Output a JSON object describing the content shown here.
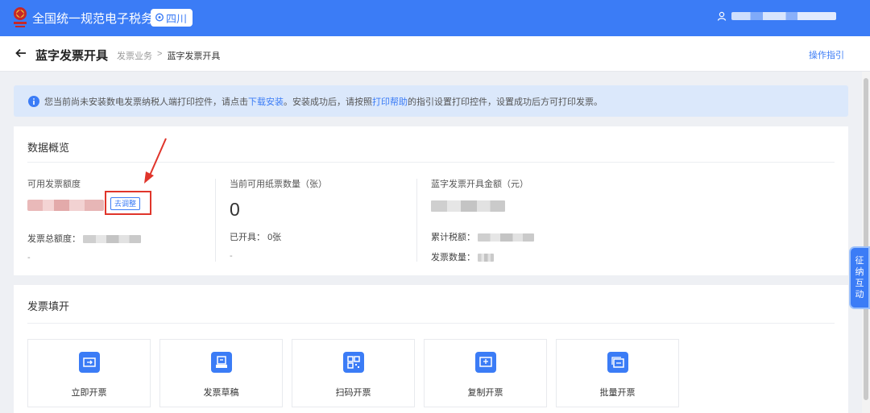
{
  "header": {
    "brand": "全国统一规范电子税务局",
    "region": "四川"
  },
  "page": {
    "title": "蓝字发票开具",
    "breadcrumb": [
      "发票业务",
      "蓝字发票开具"
    ],
    "breadcrumb_sep": ">",
    "guide": "操作指引"
  },
  "notice": {
    "text1": "您当前尚未安装数电发票纳税人端打印控件，请点击",
    "link1": "下载安装",
    "text2": "。安装成功后，请按照",
    "link2": "打印帮助",
    "text3": "的指引设置打印控件，设置成功后方可打印发票。"
  },
  "overview": {
    "title": "数据概览",
    "quota_label": "可用发票额度",
    "adjust_button": "去调整",
    "total_quota_label": "发票总额度：",
    "dash": "-",
    "paper_label": "当前可用纸票数量（张）",
    "paper_value": "0",
    "issued_label": "已开具：",
    "issued_value": "0张",
    "amount_label": "蓝字发票开具金额（元）",
    "tax_label": "累计税额：",
    "count_label": "发票数量："
  },
  "fill": {
    "title": "发票填开",
    "tiles": [
      {
        "label": "立即开票",
        "icon": "ticket-icon"
      },
      {
        "label": "发票草稿",
        "icon": "draft-icon"
      },
      {
        "label": "扫码开票",
        "icon": "qr-code-icon"
      },
      {
        "label": "复制开票",
        "icon": "copy-invoice-icon"
      },
      {
        "label": "批量开票",
        "icon": "batch-invoice-icon"
      }
    ]
  },
  "side_tab": [
    "征",
    "纳",
    "互",
    "动"
  ],
  "colors": {
    "primary": "#3b7cf6",
    "highlight": "#e0352b",
    "notice_bg": "#dbe8fb"
  }
}
